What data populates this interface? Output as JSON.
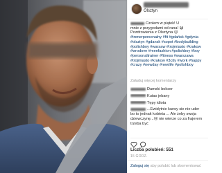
{
  "post": {
    "location": "Olsztyn",
    "caption_lines": [
      "Czołem w piątek! U",
      "mnie z przygodami od rana! 😅",
      "Pozdrowienia z Olsztyna 😊",
      "#trenerpersonalny #fit #gdańsk #gdynia",
      "#olsztyn #gdansk #sopot #bodybuilding",
      "#polishboy #warsaw #trojmiasto #krakow",
      "#wrodove #menfashion #polishboy #boy",
      "#personaltrainer #fitness #warszawa",
      "#trojmiasto #krakow #3city #work #happy",
      "#crazy #newday #newlife #polishboy"
    ],
    "more_comments": "Załaduj więcej komentarzy",
    "comments": [
      {
        "lines": [
          "Damski bokser"
        ]
      },
      {
        "lines": [
          "Kutas jebany"
        ]
      },
      {
        "lines": [
          "Tępy idiota"
        ]
      },
      {
        "lines": [
          "...Ewidytnie kurwy sie nie uder",
          "bo to jednak kobieta ... Ale żeby swoja",
          "dziewczynę...😢 nie wierze co za frajerem",
          "trzeba być"
        ]
      }
    ],
    "likes": "Liczba polubień: 551",
    "date": "15 GODZ.",
    "footer": {
      "login_link": "Zaloguj się",
      "rest": "aby polubić lub skomentować"
    }
  },
  "icons": {
    "like": "heart-icon",
    "comment": "comment-icon"
  },
  "colors": {
    "link": "#003569",
    "muted": "#999999",
    "text": "#262626"
  }
}
